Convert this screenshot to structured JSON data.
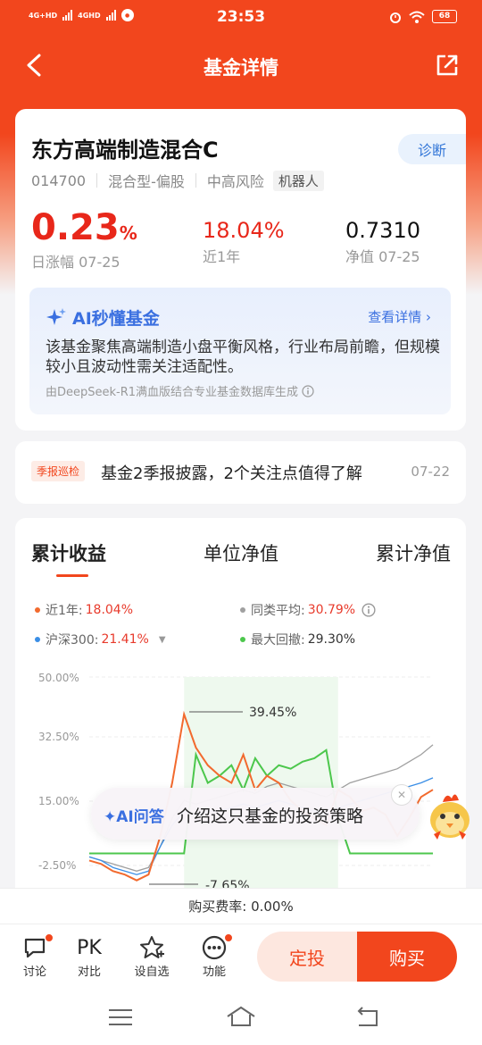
{
  "status_bar": {
    "network1": "4G+HD",
    "network2": "4GHD",
    "time": "23:53",
    "battery": "68"
  },
  "nav": {
    "title": "基金详情"
  },
  "fund": {
    "name": "东方高端制造混合C",
    "diagnose_label": "诊断",
    "code": "014700",
    "category": "混合型-偏股",
    "risk": "中高风险",
    "tag": "机器人",
    "daily_change": "0.23",
    "daily_change_unit": "%",
    "daily_change_label": "日涨幅 07-25",
    "year_return": "18.04%",
    "year_return_label": "近1年",
    "nav_value": "0.7310",
    "nav_label": "净值 07-25"
  },
  "ai_summary": {
    "title": "AI秒懂基金",
    "more": "查看详情",
    "text": "该基金聚焦高端制造小盘平衡风格，行业布局前瞻，但规模较小且波动性需关注适配性。",
    "footer": "由DeepSeek-R1满血版结合专业基金数据库生成"
  },
  "report": {
    "tag": "季报巡检",
    "text": "基金2季报披露，2个关注点值得了解",
    "date": "07-22"
  },
  "chart_tabs": [
    "累计收益",
    "单位净值",
    "累计净值"
  ],
  "legend": {
    "year_label": "近1年:",
    "year_value": "18.04%",
    "peer_label": "同类平均:",
    "peer_value": "30.79%",
    "index_label": "沪深300:",
    "index_value": "21.41%",
    "drawdown_label": "最大回撤:",
    "drawdown_value": "29.30%"
  },
  "colors": {
    "brand": "#f2461d",
    "fund_line": "#f26a2e",
    "peer_line": "#a0a0a0",
    "index_line": "#3a8ee6",
    "drawdown": "#4cc74c"
  },
  "chart_data": {
    "type": "line",
    "ylabel": "",
    "y_ticks": [
      "50.00%",
      "32.50%",
      "15.00%",
      "-2.50%"
    ],
    "ylim": [
      -10,
      50
    ],
    "annotations": [
      "39.45%",
      "-7.65%"
    ],
    "series": [
      {
        "name": "近1年",
        "values": [
          -2,
          -3,
          -5,
          -6,
          -7.65,
          -6,
          5,
          20,
          39.45,
          30,
          25,
          22,
          20,
          28,
          18,
          22,
          20,
          15,
          12,
          10,
          8,
          18,
          16,
          12,
          13,
          11,
          5,
          10,
          16,
          18.04
        ]
      },
      {
        "name": "同类平均",
        "values": [
          -1,
          -2,
          -3,
          -4,
          -5,
          -4,
          2,
          10,
          15,
          14,
          15,
          16,
          17,
          18,
          17,
          19,
          20,
          19,
          18,
          17,
          16,
          18,
          20,
          21,
          22,
          23,
          24,
          26,
          28,
          30.79
        ]
      },
      {
        "name": "沪深300",
        "values": [
          -1,
          -2,
          -4,
          -5,
          -6,
          -5,
          2,
          8,
          12,
          11,
          12,
          12,
          13,
          14,
          13,
          14,
          15,
          14,
          13,
          12,
          11,
          13,
          14,
          15,
          16,
          17,
          18,
          19,
          20,
          21.41
        ]
      },
      {
        "name": "最大回撤",
        "values": [
          0,
          0,
          0,
          0,
          0,
          0,
          0,
          0,
          0,
          28,
          20,
          22,
          25,
          18,
          27,
          22,
          25,
          24,
          26,
          27,
          29.3,
          10,
          0,
          0,
          0,
          0,
          0,
          0,
          0,
          0
        ]
      }
    ]
  },
  "ai_ask": {
    "label": "AI问答",
    "text": "介绍这只基金的投资策略"
  },
  "fee": "购买费率: 0.00%",
  "bottom": {
    "discuss": "讨论",
    "pk_icon": "PK",
    "compare": "对比",
    "watch": "设自选",
    "func": "功能",
    "dingtou": "定投",
    "buy": "购买"
  }
}
